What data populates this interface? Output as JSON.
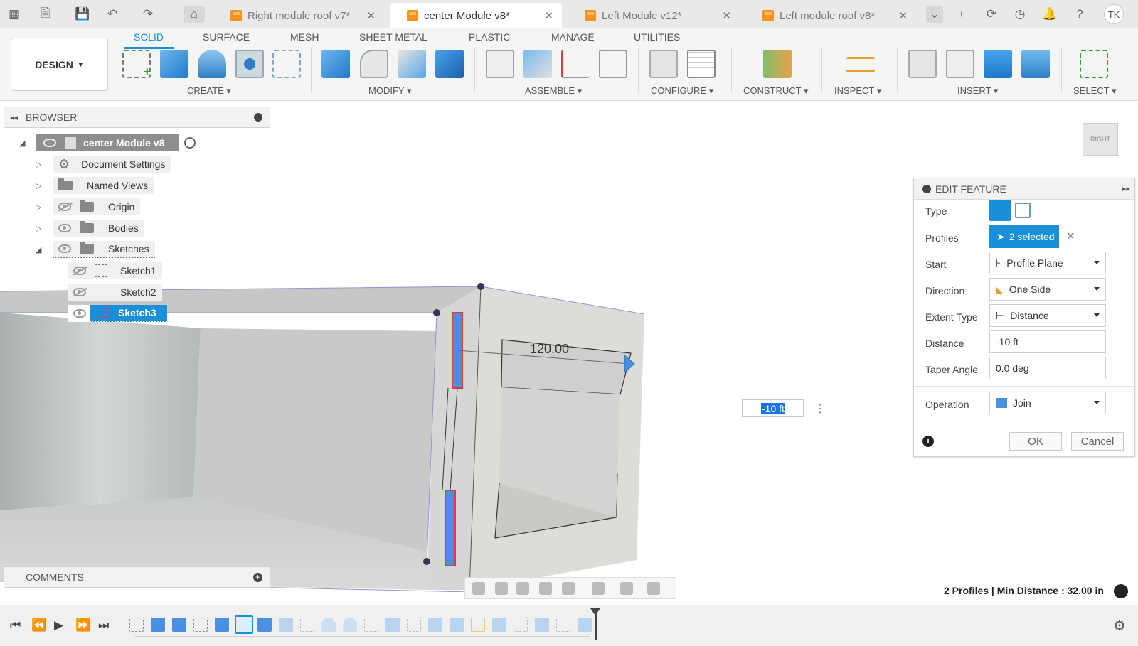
{
  "title_bar": {
    "tabs": [
      {
        "label": "Right module roof v7*",
        "active": false
      },
      {
        "label": "center Module v8*",
        "active": true
      },
      {
        "label": "Left Module v12*",
        "active": false
      },
      {
        "label": "Left module roof v8*",
        "active": false
      }
    ],
    "user_initials": "TK"
  },
  "ribbon": {
    "workspace": "DESIGN",
    "tabs": [
      "SOLID",
      "SURFACE",
      "MESH",
      "SHEET METAL",
      "PLASTIC",
      "MANAGE",
      "UTILITIES"
    ],
    "active_tab": "SOLID",
    "groups": [
      "CREATE",
      "MODIFY",
      "ASSEMBLE",
      "CONFIGURE",
      "CONSTRUCT",
      "INSPECT",
      "INSERT",
      "SELECT"
    ]
  },
  "browser": {
    "title": "BROWSER",
    "root": "center Module v8",
    "items": [
      "Document Settings",
      "Named Views",
      "Origin",
      "Bodies",
      "Sketches"
    ],
    "sketches": [
      "Sketch1",
      "Sketch2",
      "Sketch3"
    ],
    "selected_sketch": "Sketch3"
  },
  "comments": {
    "title": "COMMENTS"
  },
  "edit_feature": {
    "title": "EDIT FEATURE",
    "labels": {
      "type": "Type",
      "profiles": "Profiles",
      "start": "Start",
      "direction": "Direction",
      "extent_type": "Extent Type",
      "distance": "Distance",
      "taper_angle": "Taper Angle",
      "operation": "Operation"
    },
    "values": {
      "profiles": "2 selected",
      "start": "Profile Plane",
      "direction": "One Side",
      "extent_type": "Distance",
      "distance": "-10 ft",
      "taper_angle": "0.0 deg",
      "operation": "Join"
    },
    "ok": "OK",
    "cancel": "Cancel"
  },
  "canvas": {
    "dimension_label": "120.00",
    "distance_input": "-10 ft",
    "viewcube_face": "RIGHT"
  },
  "status": "2 Profiles | Min Distance : 32.00 in",
  "colors": {
    "accent": "#1a8fd8",
    "selection_red": "#e53935",
    "profile_blue": "#4a90e2"
  }
}
